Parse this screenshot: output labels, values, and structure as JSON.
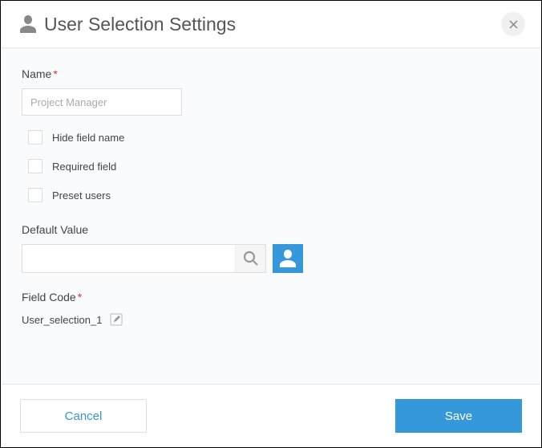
{
  "header": {
    "title": "User Selection Settings"
  },
  "form": {
    "name": {
      "label": "Name",
      "value": "Project Manager"
    },
    "checkboxes": {
      "hide_field": "Hide field name",
      "required_field": "Required field",
      "preset_users": "Preset users"
    },
    "default_value": {
      "label": "Default Value"
    },
    "field_code": {
      "label": "Field Code",
      "value": "User_selection_1"
    }
  },
  "footer": {
    "cancel": "Cancel",
    "save": "Save"
  }
}
